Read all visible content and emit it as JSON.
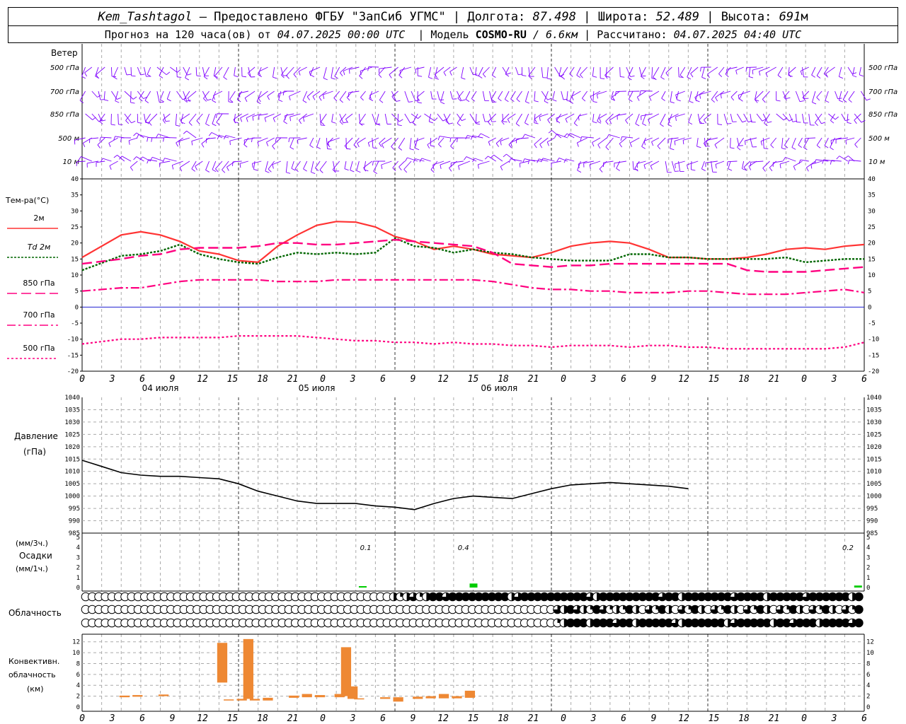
{
  "header": {
    "station": "Kem_Tashtagol",
    "provider_label": "— Предоставлено ФГБУ \"ЗапСиб УГМС\"",
    "lon_label": "Долгота:",
    "lon": "87.498",
    "lat_label": "Широта:",
    "lat": "52.489",
    "alt_label": "Высота:",
    "alt": "691",
    "alt_unit": "м",
    "forecast_label": "Прогноз на 120 часа(ов) от",
    "forecast_from": "04.07.2025 00:00 UTC",
    "model_label": "Модель",
    "model": "COSMO-RU",
    "resolution": "/ 6.6км",
    "computed_label": "Рассчитано:",
    "computed": "04.07.2025 04:40 UTC"
  },
  "colors": {
    "wind": "#7f00ff",
    "t2m": "#ff3333",
    "td2m": "#006600",
    "t850": "#ff0080",
    "zero_line": "#0000cc",
    "precip": "#00cc00",
    "conv": "#ee8833",
    "grid": "#aaaaaa"
  },
  "time_axis": {
    "hour_labels": [
      "0",
      "3",
      "6",
      "9",
      "12",
      "15",
      "18",
      "21",
      "0",
      "3",
      "6",
      "9",
      "12",
      "15",
      "18",
      "21",
      "0",
      "3",
      "6",
      "9",
      "12",
      "15",
      "18",
      "21",
      "0",
      "3",
      "6"
    ],
    "day_labels": [
      "04 июля",
      "05 июля",
      "06 июля"
    ]
  },
  "wind_panel": {
    "title": "Ветер",
    "levels": [
      "500 гПа",
      "700 гПа",
      "850 гПа",
      "500 м",
      "10 м"
    ]
  },
  "temp_panel": {
    "title": "Тем-ра(°C)",
    "legend": [
      {
        "label": "2м",
        "style": "solid"
      },
      {
        "label": "Td  2м",
        "style": "dotted"
      },
      {
        "label": "850 гПа",
        "style": "dashed"
      },
      {
        "label": "700 гПа",
        "style": "dashdot"
      },
      {
        "label": "500 гПа",
        "style": "dense-dot"
      }
    ],
    "y_ticks": [
      "40",
      "35",
      "30",
      "25",
      "20",
      "15",
      "10",
      "5",
      "0",
      "-5",
      "-10",
      "-15",
      "-20"
    ]
  },
  "pressure_panel": {
    "title": "Давление",
    "unit": "(гПа)",
    "y_ticks": [
      "1040",
      "1035",
      "1030",
      "1025",
      "1020",
      "1015",
      "1010",
      "1005",
      "1000",
      "995",
      "990",
      "985"
    ]
  },
  "precip_panel": {
    "unit_3h": "(мм/3ч.)",
    "title": "Осадки",
    "unit_1h": "(мм/1ч.)",
    "y_ticks": [
      "5",
      "4",
      "3",
      "2",
      "1",
      "0"
    ],
    "totals": [
      "0.1",
      "0.4",
      "0.2"
    ]
  },
  "cloud_panel": {
    "title": "Облачность"
  },
  "conv_panel": {
    "title_1": "Конвективн.",
    "title_2": "облачность",
    "unit": "(км)",
    "y_ticks": [
      "12",
      "10",
      "8",
      "6",
      "4",
      "2",
      "0"
    ]
  },
  "chart_data": [
    {
      "type": "line",
      "name": "temperature",
      "ylim": [
        -20,
        40
      ],
      "x_hours": [
        0,
        6,
        9,
        12,
        15,
        18,
        21,
        24,
        27,
        30,
        33,
        36,
        39,
        42,
        45,
        48,
        51,
        54,
        57,
        60,
        63,
        66,
        69,
        72,
        75,
        78,
        81,
        84,
        87,
        90,
        93,
        96,
        99,
        102,
        105,
        108,
        111,
        114,
        117,
        120
      ],
      "series": [
        {
          "name": "2м",
          "values": [
            15.5,
            22.5,
            23.5,
            22.5,
            20.5,
            17.5,
            16.5,
            14.5,
            14,
            19,
            22.5,
            25.5,
            26.7,
            26.5,
            25,
            22,
            20.5,
            18,
            19,
            18,
            16.5,
            16,
            15.5,
            17,
            19,
            20,
            20.5,
            20,
            18,
            15.5,
            15.5,
            15,
            15,
            15.5,
            16.5,
            18,
            18.5,
            18,
            19,
            19.5
          ]
        },
        {
          "name": "Td  2м",
          "values": [
            11.5,
            16,
            16.5,
            17.5,
            19.5,
            16.5,
            15,
            14,
            13.5,
            15.5,
            17,
            16.5,
            17,
            16.5,
            17,
            21.5,
            19,
            18.5,
            17,
            18,
            17,
            16.5,
            15.5,
            15,
            14.5,
            14.5,
            14.5,
            16.5,
            16.5,
            15.5,
            15.5,
            15,
            15,
            15,
            15,
            15.5,
            14,
            14.5,
            15,
            15
          ]
        },
        {
          "name": "850 гПа",
          "values": [
            13.5,
            15,
            16,
            16.5,
            18,
            18.5,
            18.5,
            18.5,
            19,
            20,
            20,
            19.5,
            19.5,
            20,
            20.5,
            21,
            20.5,
            20,
            19.5,
            19,
            17,
            13.5,
            13,
            12.5,
            13,
            13,
            13.5,
            13.5,
            13.5,
            13.5,
            13.5,
            13.5,
            13.5,
            11.5,
            11,
            11,
            11,
            11.5,
            12,
            12.5
          ]
        },
        {
          "name": "700 гПа",
          "values": [
            5,
            6,
            6,
            7,
            8,
            8.5,
            8.5,
            8.5,
            8.5,
            8,
            8,
            8,
            8.5,
            8.5,
            8.5,
            8.5,
            8.5,
            8.5,
            8.5,
            8.5,
            8,
            7,
            6,
            5.5,
            5.5,
            5,
            5,
            4.5,
            4.5,
            4.5,
            5,
            5,
            4.5,
            4,
            4,
            4,
            4.5,
            5,
            5.5,
            4.5
          ]
        },
        {
          "name": "500 гПа",
          "values": [
            -11.5,
            -10,
            -10,
            -9.5,
            -9.5,
            -9.5,
            -9.5,
            -9,
            -9,
            -9,
            -9,
            -9.5,
            -10,
            -10.5,
            -10.5,
            -11,
            -11,
            -11.5,
            -11,
            -11.5,
            -11.5,
            -12,
            -12,
            -12.5,
            -12,
            -12,
            -12,
            -12.5,
            -12,
            -12,
            -12.5,
            -12.5,
            -13,
            -13,
            -13,
            -13,
            -13,
            -13,
            -12.5,
            -11
          ]
        }
      ]
    },
    {
      "type": "line",
      "name": "pressure",
      "ylim": [
        985,
        1040
      ],
      "x_hours": [
        0,
        3,
        6,
        9,
        12,
        15,
        18,
        21,
        24,
        27,
        30,
        33,
        36,
        39,
        42,
        45,
        48,
        51,
        54,
        57,
        60,
        63,
        66,
        69,
        72,
        75,
        78,
        81,
        84,
        87,
        90,
        93,
        96,
        99,
        102,
        105,
        108,
        111,
        114,
        117,
        120
      ],
      "series": [
        {
          "name": "Давление",
          "values": [
            1014.5,
            1012,
            1009.5,
            1008.5,
            1008,
            1008,
            1007.5,
            1007,
            1005,
            1002,
            1000,
            998,
            997,
            997,
            997,
            996,
            995.5,
            994.5,
            997,
            999,
            1000,
            999.5,
            999,
            1001,
            1003,
            1004.5,
            1005,
            1005.5,
            1005,
            1004.5,
            1004,
            1003
          ]
        }
      ]
    },
    {
      "type": "bar",
      "name": "precipitation",
      "ylim": [
        0,
        5
      ],
      "x_hours": [
        43,
        60,
        119
      ],
      "values": [
        0.1,
        0.4,
        0.2
      ]
    },
    {
      "type": "bar",
      "name": "convective_cloudiness",
      "ylim": [
        0,
        13
      ],
      "bars": [
        {
          "x": 6.5,
          "base": 1.8,
          "top": 2.1
        },
        {
          "x": 8.5,
          "base": 1.9,
          "top": 2.2
        },
        {
          "x": 12.5,
          "base": 2.0,
          "top": 2.3
        },
        {
          "x": 21.5,
          "base": 4.5,
          "top": 11.8
        },
        {
          "x": 22.5,
          "base": 1.2,
          "top": 1.4
        },
        {
          "x": 24.5,
          "base": 1.2,
          "top": 1.5
        },
        {
          "x": 25.5,
          "base": 1.5,
          "top": 12.5
        },
        {
          "x": 26.5,
          "base": 1.2,
          "top": 1.5
        },
        {
          "x": 28.5,
          "base": 1.2,
          "top": 1.7
        },
        {
          "x": 32.5,
          "base": 1.7,
          "top": 2.1
        },
        {
          "x": 34.5,
          "base": 1.8,
          "top": 2.4
        },
        {
          "x": 36.5,
          "base": 1.8,
          "top": 2.2
        },
        {
          "x": 39.5,
          "base": 1.8,
          "top": 2.4
        },
        {
          "x": 40.5,
          "base": 2.0,
          "top": 11.0
        },
        {
          "x": 41.5,
          "base": 1.5,
          "top": 3.8
        },
        {
          "x": 42.5,
          "base": 1.4,
          "top": 1.6
        },
        {
          "x": 46.5,
          "base": 1.5,
          "top": 1.8
        },
        {
          "x": 48.5,
          "base": 1.0,
          "top": 1.8
        },
        {
          "x": 51.5,
          "base": 1.5,
          "top": 1.9
        },
        {
          "x": 53.5,
          "base": 1.6,
          "top": 2.0
        },
        {
          "x": 55.5,
          "base": 1.6,
          "top": 2.4
        },
        {
          "x": 57.5,
          "base": 1.6,
          "top": 2.0
        },
        {
          "x": 59.5,
          "base": 1.7,
          "top": 3.0
        }
      ]
    }
  ]
}
